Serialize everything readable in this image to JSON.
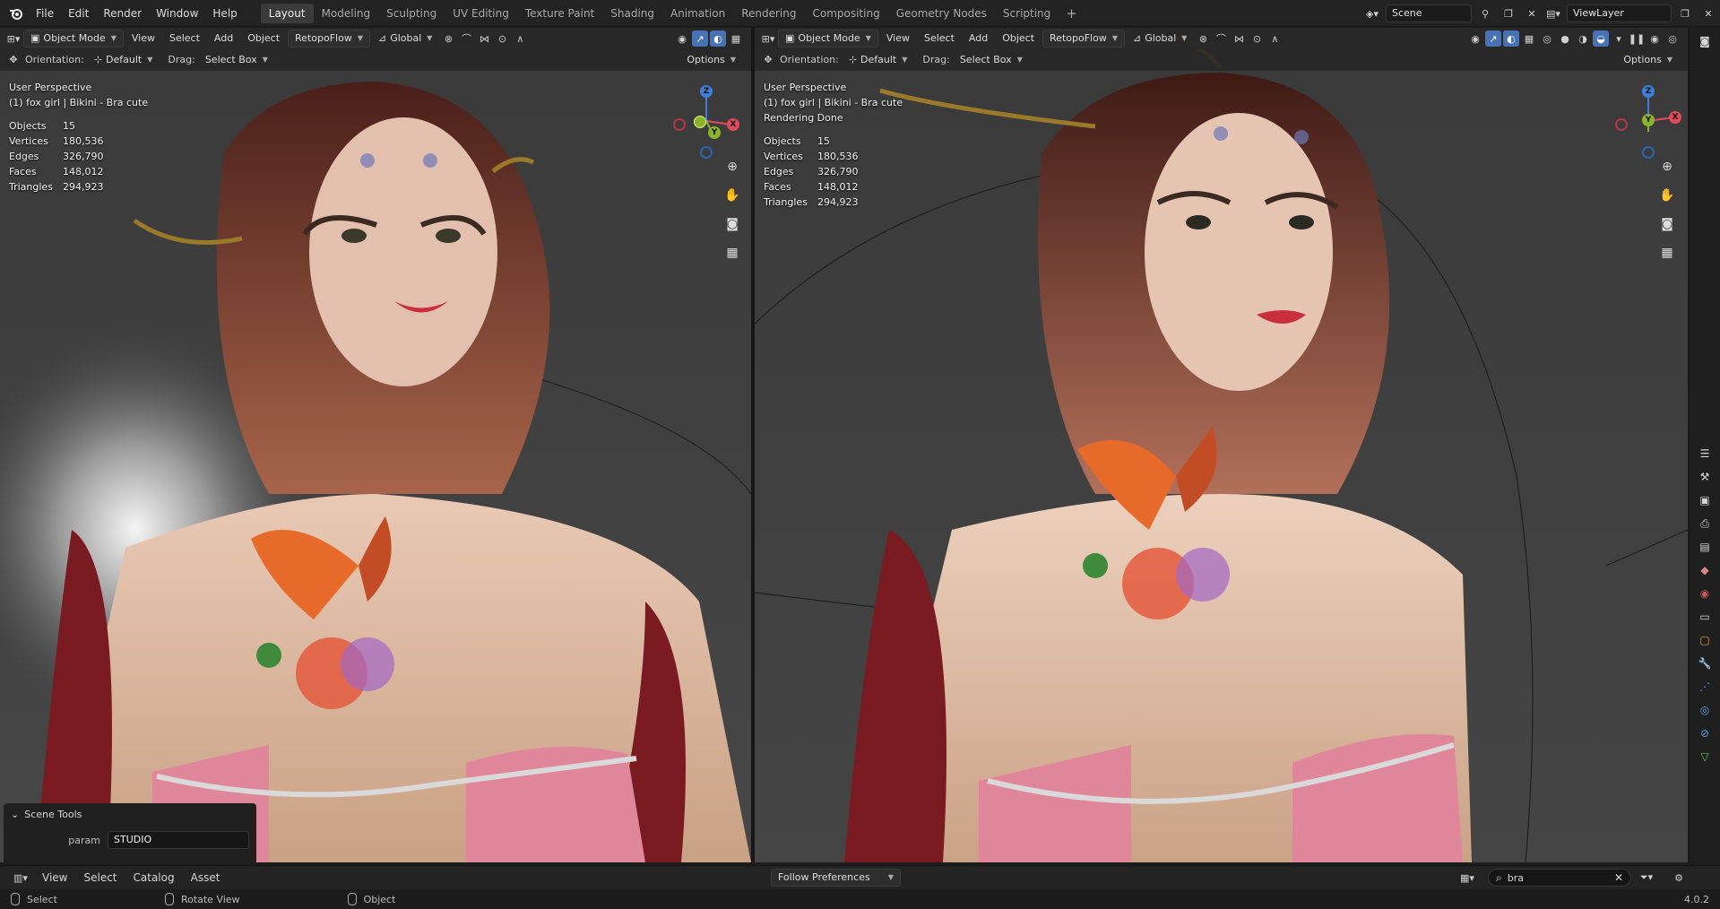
{
  "topbar": {
    "menu": [
      "File",
      "Edit",
      "Render",
      "Window",
      "Help"
    ],
    "workspaces": [
      "Layout",
      "Modeling",
      "Sculpting",
      "UV Editing",
      "Texture Paint",
      "Shading",
      "Animation",
      "Rendering",
      "Compositing",
      "Geometry Nodes",
      "Scripting"
    ],
    "active_workspace": "Layout",
    "add_workspace": "+",
    "scene": "Scene",
    "view_layer": "ViewLayer"
  },
  "left_viewport": {
    "mode": "Object Mode",
    "menu": [
      "View",
      "Select",
      "Add",
      "Object"
    ],
    "retopoflow": "RetopoFlow",
    "transform": "Global",
    "orientation_label": "Orientation:",
    "orientation_value": "Default",
    "drag_label": "Drag:",
    "drag_value": "Select Box",
    "options": "Options",
    "perspective": "User Perspective",
    "object_info": "(1) fox girl | Bikini - Bra cute",
    "stats": [
      {
        "label": "Objects",
        "value": "15"
      },
      {
        "label": "Vertices",
        "value": "180,536"
      },
      {
        "label": "Edges",
        "value": "326,790"
      },
      {
        "label": "Faces",
        "value": "148,012"
      },
      {
        "label": "Triangles",
        "value": "294,923"
      }
    ]
  },
  "right_viewport": {
    "mode": "Object Mode",
    "menu": [
      "View",
      "Select",
      "Add",
      "Object"
    ],
    "retopoflow": "RetopoFlow",
    "transform": "Global",
    "orientation_label": "Orientation:",
    "orientation_value": "Default",
    "drag_label": "Drag:",
    "drag_value": "Select Box",
    "options": "Options",
    "perspective": "User Perspective",
    "object_info": "(1) fox girl | Bikini - Bra cute",
    "render_status": "Rendering Done",
    "stats": [
      {
        "label": "Objects",
        "value": "15"
      },
      {
        "label": "Vertices",
        "value": "180,536"
      },
      {
        "label": "Edges",
        "value": "326,790"
      },
      {
        "label": "Faces",
        "value": "148,012"
      },
      {
        "label": "Triangles",
        "value": "294,923"
      }
    ]
  },
  "gizmo": {
    "z": "Z",
    "y": "Y",
    "x": "X"
  },
  "scene_tools": {
    "title": "Scene Tools",
    "param_label": "param",
    "param_value": "STUDIO"
  },
  "asset_bar": {
    "menu": [
      "View",
      "Select",
      "Catalog",
      "Asset"
    ],
    "library": "Follow Preferences",
    "search_value": "bra"
  },
  "status_bar": {
    "select": "Select",
    "rotate": "Rotate View",
    "object": "Object",
    "version": "4.0.2"
  },
  "colors": {
    "accent": "#4772b3",
    "axis_x": "#e04a5a",
    "axis_y": "#8bb32b",
    "axis_z": "#3d7fd6"
  }
}
